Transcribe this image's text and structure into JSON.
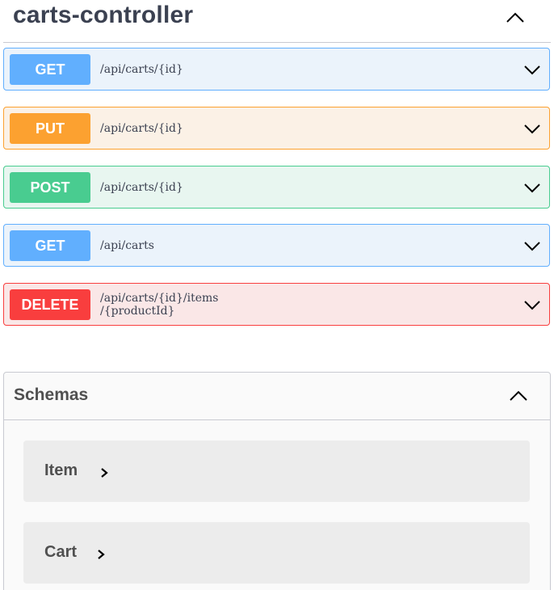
{
  "tag": {
    "title": "carts-controller",
    "collapse_icon": "chevron-up-icon"
  },
  "operations": [
    {
      "method": "GET",
      "path": "/api/carts/{id}",
      "color": "#61affe",
      "background": "#ebf3fb"
    },
    {
      "method": "PUT",
      "path": "/api/carts/{id}",
      "color": "#fca130",
      "background": "#fbf1e6"
    },
    {
      "method": "POST",
      "path": "/api/carts/{id}",
      "color": "#49cc90",
      "background": "#e8f6f0"
    },
    {
      "method": "GET",
      "path": "/api/carts",
      "color": "#61affe",
      "background": "#ebf3fb"
    },
    {
      "method": "DELETE",
      "path": "/api/carts/{id}/items\n/{productId}",
      "color": "#f93e3e",
      "background": "#fae7e7"
    }
  ],
  "schemas": {
    "title": "Schemas",
    "collapse_icon": "chevron-up-icon",
    "models": [
      {
        "name": "Item",
        "expand_icon": "chevron-right-icon"
      },
      {
        "name": "Cart",
        "expand_icon": "chevron-right-icon"
      }
    ]
  }
}
